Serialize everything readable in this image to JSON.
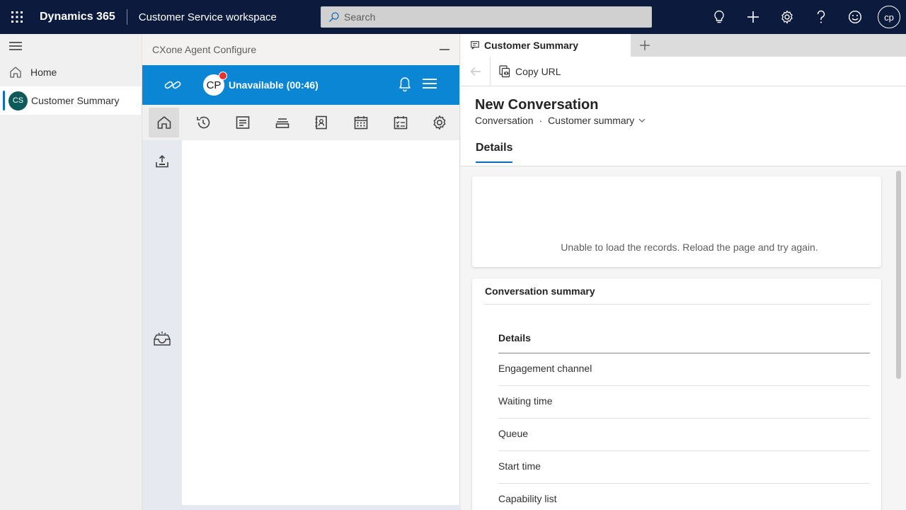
{
  "topbar": {
    "brand": "Dynamics 365",
    "app_name": "Customer Service workspace",
    "search_placeholder": "Search",
    "user_initials": "cp"
  },
  "leftnav": {
    "home_label": "Home",
    "session_badge": "CS",
    "session_label": "Customer Summary"
  },
  "cxone": {
    "title": "CXone Agent Configure",
    "agent_initials": "CP",
    "status_text": "Unavailable (00:46)",
    "status_color": "#0b86d4",
    "tabs": [
      "home-icon",
      "history-icon",
      "notes-icon",
      "queue-icon",
      "directory-icon",
      "calendar-icon",
      "schedule-icon",
      "settings-icon"
    ]
  },
  "right": {
    "tab_label": "Customer Summary",
    "copy_url_label": "Copy URL",
    "form_title": "New Conversation",
    "entity": "Conversation",
    "separator": "·",
    "form_name": "Customer summary",
    "active_tab": "Details",
    "error_message": "Unable to load the records. Reload the page and try again.",
    "summary_title": "Conversation summary",
    "section_title": "Details",
    "fields": [
      "Engagement channel",
      "Waiting time",
      "Queue",
      "Start time",
      "Capability list"
    ]
  }
}
